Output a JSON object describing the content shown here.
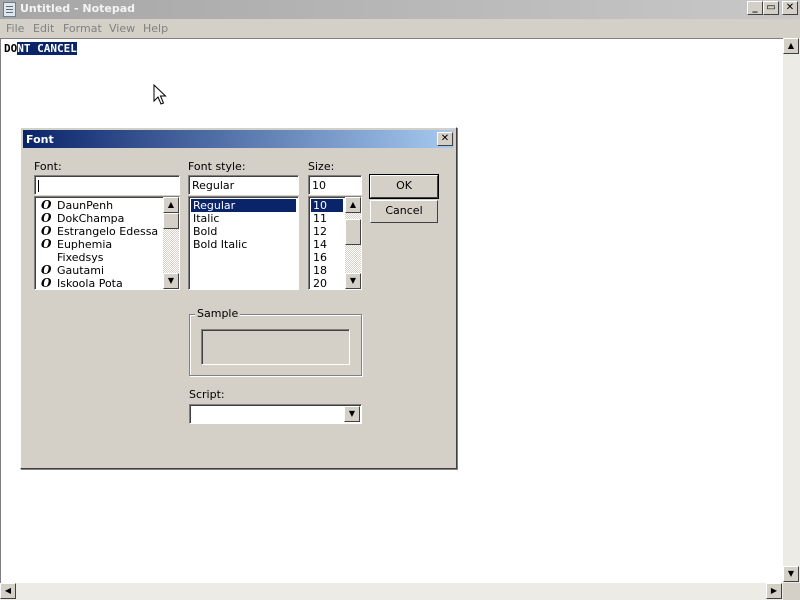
{
  "window": {
    "title": "Untitled - Notepad",
    "controls": {
      "minimize": "_",
      "maximize": "▭",
      "close": "✕"
    }
  },
  "menu": [
    "File",
    "Edit",
    "Format",
    "View",
    "Help"
  ],
  "editor": {
    "text_unselected": "DO",
    "text_selected": "NT CANCEL"
  },
  "font_dialog": {
    "title": "Font",
    "close_glyph": "✕",
    "font_label": "Font:",
    "font_value": "",
    "fonts": [
      {
        "name": "DaunPenh",
        "icon": "opentype-icon"
      },
      {
        "name": "DokChampa",
        "icon": "opentype-icon"
      },
      {
        "name": "Estrangelo Edessa",
        "icon": "opentype-icon"
      },
      {
        "name": "Euphemia",
        "icon": "opentype-icon"
      },
      {
        "name": "Fixedsys",
        "icon": ""
      },
      {
        "name": "Gautami",
        "icon": "opentype-icon"
      },
      {
        "name": "Iskoola Pota",
        "icon": "opentype-icon"
      }
    ],
    "opentype_glyph": "O",
    "style_label": "Font style:",
    "style_value": "Regular",
    "styles": [
      "Regular",
      "Italic",
      "Bold",
      "Bold Italic"
    ],
    "selected_style_index": 0,
    "size_label": "Size:",
    "size_value": "10",
    "sizes": [
      "10",
      "11",
      "12",
      "14",
      "16",
      "18",
      "20"
    ],
    "selected_size_index": 0,
    "ok_label": "OK",
    "cancel_label": "Cancel",
    "sample_label": "Sample",
    "script_label": "Script:",
    "script_value": ""
  },
  "scroll_glyphs": {
    "up": "▲",
    "down": "▼",
    "left": "◀",
    "right": "▶"
  },
  "colors": {
    "selection": "#0a246a",
    "dialog_title_start": "#0a246a",
    "dialog_title_end": "#a6caf0",
    "face": "#d4d0c8"
  }
}
